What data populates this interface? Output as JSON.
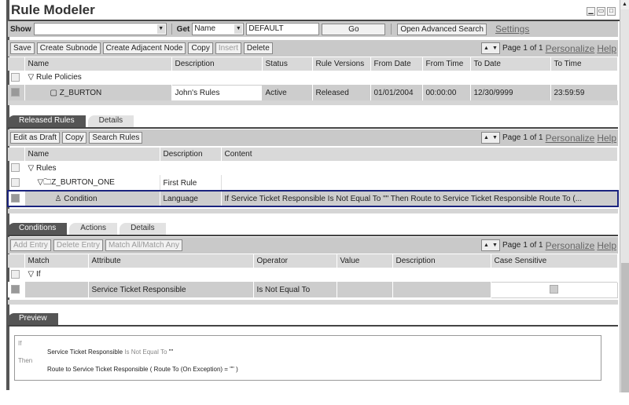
{
  "title": "Rule Modeler",
  "window_buttons": [
    "minimize-icon",
    "restore-icon",
    "maximize-icon"
  ],
  "search": {
    "show_label": "Show",
    "show_value": "",
    "get_label": "Get",
    "get_value": "Name",
    "query": "DEFAULT",
    "go": "Go",
    "advanced": "Open Advanced Search",
    "settings": "Settings"
  },
  "policy_toolbar": {
    "buttons": [
      "Save",
      "Create Subnode",
      "Create Adjacent Node",
      "Copy",
      "Insert",
      "Delete"
    ],
    "page_label": "Page",
    "page": "1",
    "of": "of 1",
    "personalize": "Personalize",
    "help": "Help"
  },
  "policy_table": {
    "columns": [
      "Name",
      "Description",
      "Status",
      "Rule Versions",
      "From Date",
      "From Time",
      "To Date",
      "To Time"
    ],
    "group": "Rule Policies",
    "row": [
      "Z_BURTON",
      "John's Rules",
      "Active",
      "Released",
      "01/01/2004",
      "00:00:00",
      "12/30/9999",
      "23:59:59"
    ]
  },
  "tabs1": [
    "Released Rules",
    "Details"
  ],
  "rules_toolbar": {
    "buttons": [
      "Edit as Draft",
      "Copy",
      "Search Rules"
    ],
    "page_label": "Page",
    "page": "1",
    "of": "of 1",
    "personalize": "Personalize",
    "help": "Help"
  },
  "rules_table": {
    "columns": [
      "Name",
      "Description",
      "Content"
    ],
    "group": "Rules",
    "rule": [
      "Z_BURTON_ONE",
      "First Rule",
      ""
    ],
    "condition": [
      "Condition",
      "Language",
      "If Service Ticket Responsible Is Not Equal To \"\" Then Route to Service Ticket Responsible Route To (..."
    ]
  },
  "tabs2": [
    "Conditions",
    "Actions",
    "Details"
  ],
  "cond_toolbar": {
    "buttons": [
      "Add Entry",
      "Delete Entry",
      "Match All/Match Any"
    ],
    "page_label": "Page",
    "page": "1",
    "of": "of 1",
    "personalize": "Personalize",
    "help": "Help"
  },
  "cond_table": {
    "columns": [
      "Match",
      "Attribute",
      "Operator",
      "Value",
      "Description",
      "Case Sensitive"
    ],
    "group": "If",
    "row": [
      "",
      "Service Ticket Responsible",
      "Is Not Equal To",
      "",
      ""
    ]
  },
  "tabs3": [
    "Preview"
  ],
  "preview": {
    "if": "If",
    "cond_attr": "Service Ticket Responsible",
    "cond_op": "Is Not Equal To",
    "cond_val": "\"\"",
    "then": "Then",
    "action": "Route to Service Ticket Responsible ( Route To (On Exception) = \"\" )"
  },
  "highlight_color": "#1a237e"
}
